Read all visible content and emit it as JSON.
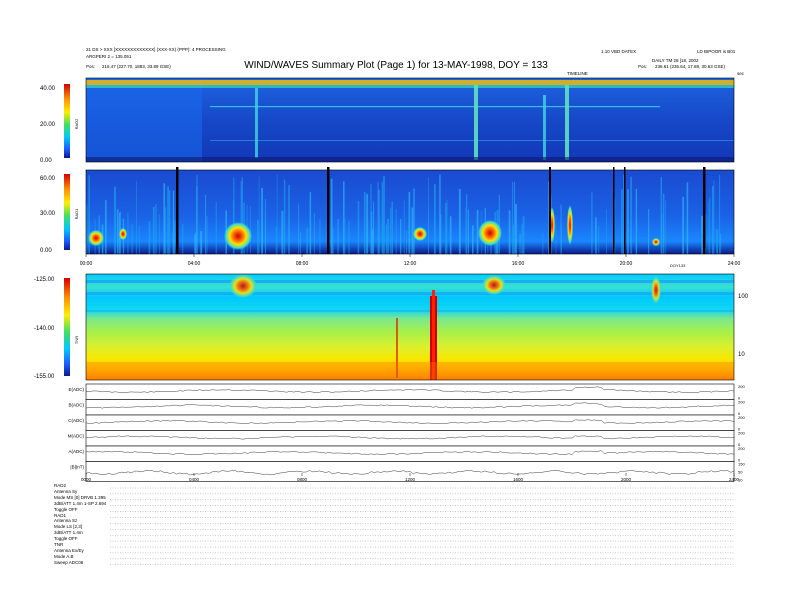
{
  "header": {
    "title": "WIND/WAVES Summary Plot (Page 1) for 13-MAY-1998, DOY = 133",
    "left_line1": "21 DS > XXX [XXXXXXXXXXXXX] (XXX-XX) (PPP): 4 PROCESSING",
    "left_line2": "ARGPERI 2 = 135.051",
    "left_line3_label": "Pos:",
    "left_line3_value": "216.47 (227.70, 1883, 33.89 GSE)",
    "right_top": "1.10 VBD DATEX",
    "right_top2": "LD BIPOOR  is B01",
    "right_line2": "DAILY TM 28 [18, 2002",
    "right_line3_label": "Pos:",
    "right_line3_value": "236.61 (236.64, 17.88, 30.63 GSE)",
    "timeline_label": "TIMELINE",
    "corner_label": "sec"
  },
  "colors": {
    "spec_low": "#0a1e96",
    "spec_mid": "#1a8cff",
    "spec_high": "#ffe000",
    "spec_peak": "#d00000",
    "tnr_band": "#00d8ff",
    "tnr_green": "#9ef050"
  },
  "chart_data": [
    {
      "type": "heatmap",
      "name": "RAD2",
      "ylabel": "RAD2",
      "yticks": [
        "40.00",
        "20.00",
        "0.00"
      ],
      "ylim": [
        0,
        40
      ],
      "colorbar": true
    },
    {
      "type": "heatmap",
      "name": "RAD1",
      "ylabel": "RAD1",
      "yticks": [
        "60.00",
        "30.00",
        "0.00"
      ],
      "ylim": [
        0,
        60
      ],
      "colorbar": true,
      "xticks": [
        "00:00",
        "04:00",
        "08:00",
        "12:00",
        "16:00",
        "20:00",
        "24:00"
      ],
      "xlim": [
        0,
        24
      ],
      "x_end_label": "DOY133"
    },
    {
      "type": "heatmap",
      "name": "TNR",
      "ylabel": "TNR",
      "yticks": [
        "-125.00",
        "-140.00",
        "-155.00"
      ],
      "ylim": [
        -155,
        -125
      ],
      "right_ticks": [
        "100",
        "10"
      ],
      "colorbar": true
    },
    {
      "type": "line",
      "name": "house-keeping traces",
      "rows": [
        {
          "label": "E(ADC)",
          "right_ticks": [
            "200",
            "0"
          ]
        },
        {
          "label": "B(ADC)",
          "right_ticks": [
            "200",
            "0"
          ]
        },
        {
          "label": "C(ADC)",
          "right_ticks": [
            "200",
            "0"
          ]
        },
        {
          "label": "M(ADC)",
          "right_ticks": [
            "200",
            "0"
          ]
        },
        {
          "label": "A(ADC)",
          "right_ticks": [
            "200",
            "0"
          ]
        },
        {
          "label": "|B|(nT)",
          "right_ticks": [
            "150",
            "50",
            "10"
          ]
        }
      ],
      "xticks": [
        "0000",
        "0400",
        "0800",
        "1200",
        "1600",
        "2000",
        "2400"
      ],
      "xlim": [
        0,
        24
      ]
    }
  ],
  "footer": {
    "rows": [
      "RAD2",
      "Antenna    Sy",
      "Mode   MS [0]     DRVB                1.395",
      "3dB/ATT 1.4m      1-SP                2.694",
      "Toggle    OFF",
      "RAD1",
      "Antenna    Sz",
      "Mode   LS [2,3]",
      "3dB/ATT 1.4m",
      "Toggle    OFF",
      "TNR",
      "Antenna  Ex/Ey",
      "Mode      A.B",
      "Sweep   ADC06"
    ]
  }
}
